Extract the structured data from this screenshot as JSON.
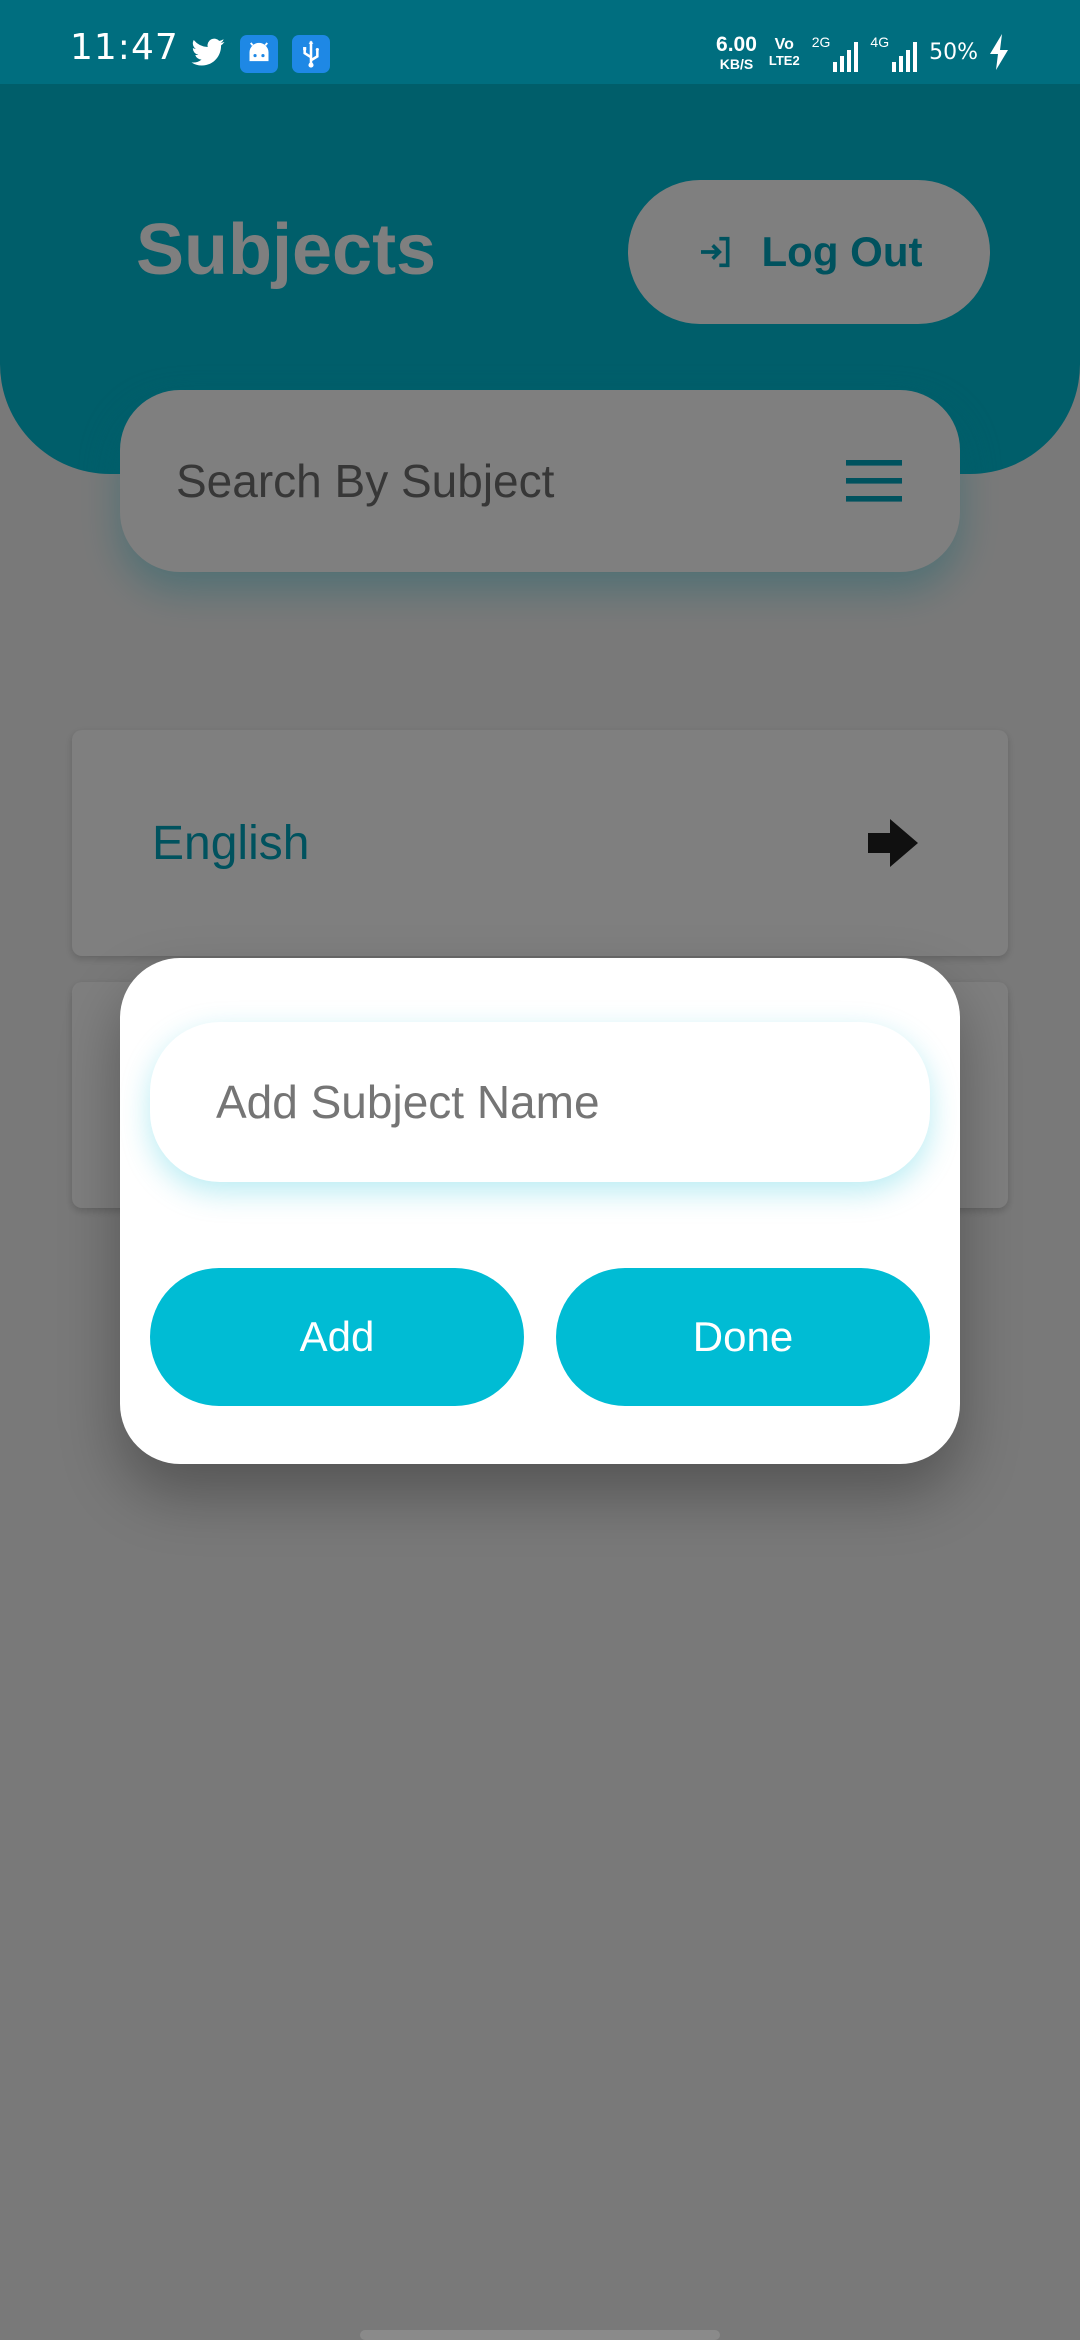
{
  "status_bar": {
    "time": "11:47",
    "speed_value": "6.00",
    "speed_unit": "KB/S",
    "volte_top": "Vo",
    "volte_bottom": "LTE2",
    "network_1": "2G",
    "network_2": "4G",
    "battery": "50%",
    "icons": [
      "twitter-icon",
      "android-icon",
      "usb-icon",
      "charging-icon"
    ]
  },
  "header": {
    "title": "Subjects",
    "logout_label": "Log Out"
  },
  "search": {
    "placeholder": "Search By Subject"
  },
  "subjects": {
    "items": [
      {
        "label": "English"
      },
      {
        "label": ""
      }
    ]
  },
  "dialog": {
    "input_placeholder": "Add Subject Name",
    "add_label": "Add",
    "done_label": "Done"
  },
  "colors": {
    "accent": "#00bcd4",
    "accent_text": "#00a4bd",
    "status_bar": "#006e7f"
  }
}
